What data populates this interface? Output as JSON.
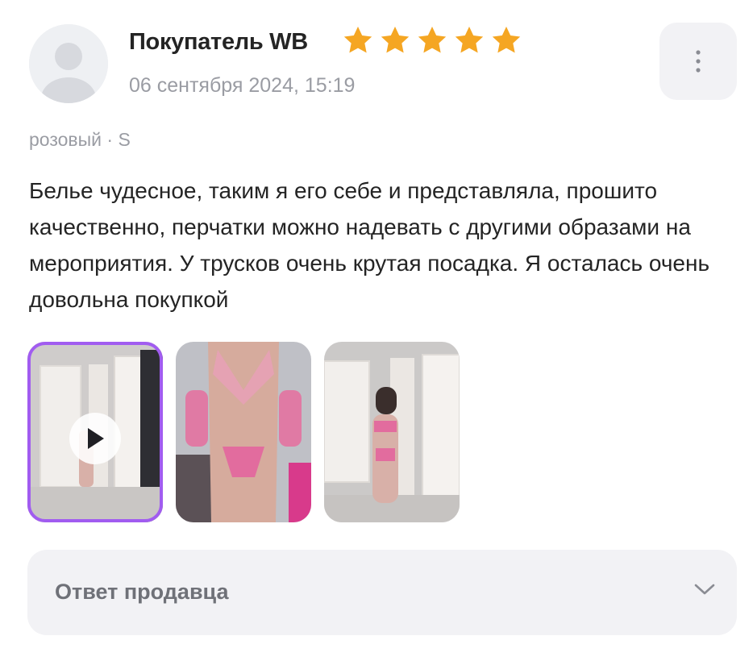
{
  "review": {
    "author": "Покупатель WB",
    "rating": 5,
    "rating_max": 5,
    "date": "06 сентября 2024, 15:19",
    "variant": "розовый · S",
    "text": "Белье чудесное, таким я его себе и представляла, прошито качественно, перчатки можно надевать с другими образами на мероприятия. У трусков очень крутая посадка. Я осталась очень довольна покупкой"
  },
  "media": [
    {
      "kind": "video",
      "icon": "play-icon"
    },
    {
      "kind": "photo"
    },
    {
      "kind": "photo"
    }
  ],
  "seller_reply": {
    "label": "Ответ продавца",
    "icon": "chevron-down-icon"
  },
  "colors": {
    "star": "#f5a623",
    "accent": "#a15cf0",
    "muted_text": "#9a9ca3",
    "panel_bg": "#f2f2f5"
  }
}
